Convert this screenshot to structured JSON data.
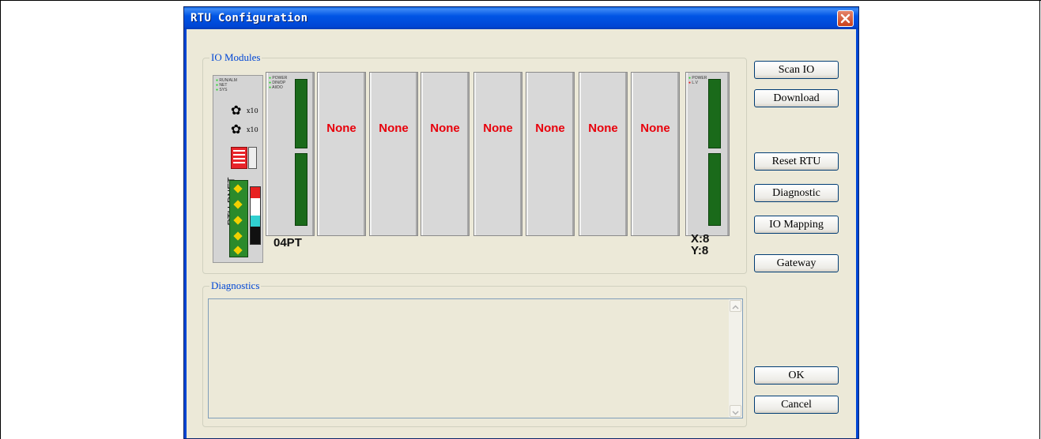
{
  "window": {
    "title": "RTU Configuration"
  },
  "io_modules": {
    "legend": "IO Modules",
    "head_label": "RTU-DNET",
    "head_leds": [
      "RUN/ALM",
      "NET",
      "SYS"
    ],
    "first_module_label": "04PT",
    "first_module_leds": [
      "POWER",
      "DIN/DP",
      "AI/DO"
    ],
    "slots": [
      "None",
      "None",
      "None",
      "None",
      "None",
      "None",
      "None"
    ],
    "end_module_leds": [
      "POWER",
      "L.V"
    ],
    "end_module_label_x": "X:8",
    "end_module_label_y": "Y:8",
    "knob_label": "x10"
  },
  "buttons": {
    "scan_io": "Scan IO",
    "download": "Download",
    "reset_rtu": "Reset RTU",
    "diagnostic": "Diagnostic",
    "io_mapping": "IO Mapping",
    "gateway": "Gateway",
    "ok": "OK",
    "cancel": "Cancel"
  },
  "diagnostics": {
    "legend": "Diagnostics",
    "content": ""
  },
  "colors": {
    "title_bar": "#0046d5",
    "none_text": "#e8000b",
    "legend_text": "#0046d5"
  },
  "icons": {
    "close": "close-icon",
    "scroll_up": "scroll-up-arrow-icon",
    "scroll_down": "scroll-down-arrow-icon"
  }
}
